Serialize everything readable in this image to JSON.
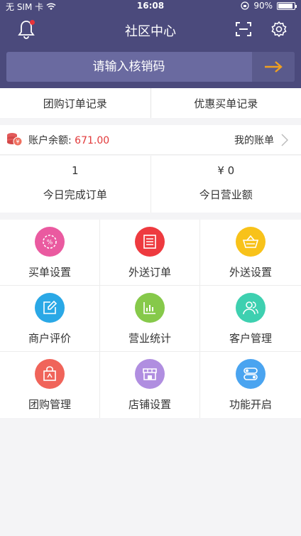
{
  "status_bar": {
    "carrier": "无 SIM 卡",
    "time": "16:08",
    "battery": "90%",
    "battery_level": 0.9
  },
  "header": {
    "title": "社区中心",
    "bell_icon": "bell-icon",
    "scan_icon": "scan-icon",
    "settings_icon": "gear-icon"
  },
  "search": {
    "placeholder": "请输入核销码",
    "go_icon": "arrow-right-icon",
    "accent": "#f0a020"
  },
  "tabs": [
    {
      "label": "团购订单记录"
    },
    {
      "label": "优惠买单记录"
    }
  ],
  "balance": {
    "label": "账户余额: ",
    "value": "671.00",
    "link": "我的账单",
    "value_color": "#e2393a"
  },
  "stats": [
    {
      "value": "1",
      "label": "今日完成订单"
    },
    {
      "value": "¥ 0",
      "label": "今日营业额"
    }
  ],
  "menu": [
    {
      "label": "买单设置",
      "icon": "discount-badge-icon",
      "color": "#ea5aa0"
    },
    {
      "label": "外送订单",
      "icon": "order-list-icon",
      "color": "#ee3a3f"
    },
    {
      "label": "外送设置",
      "icon": "basket-icon",
      "color": "#f8c21a"
    },
    {
      "label": "商户评价",
      "icon": "edit-icon",
      "color": "#2aa8e6"
    },
    {
      "label": "营业统计",
      "icon": "bar-chart-icon",
      "color": "#86c94a"
    },
    {
      "label": "客户管理",
      "icon": "users-icon",
      "color": "#3ed0b0"
    },
    {
      "label": "团购管理",
      "icon": "shopping-bag-icon",
      "color": "#f0645a"
    },
    {
      "label": "店铺设置",
      "icon": "store-icon",
      "color": "#b08ee0"
    },
    {
      "label": "功能开启",
      "icon": "toggle-icon",
      "color": "#4aa4f0"
    }
  ]
}
